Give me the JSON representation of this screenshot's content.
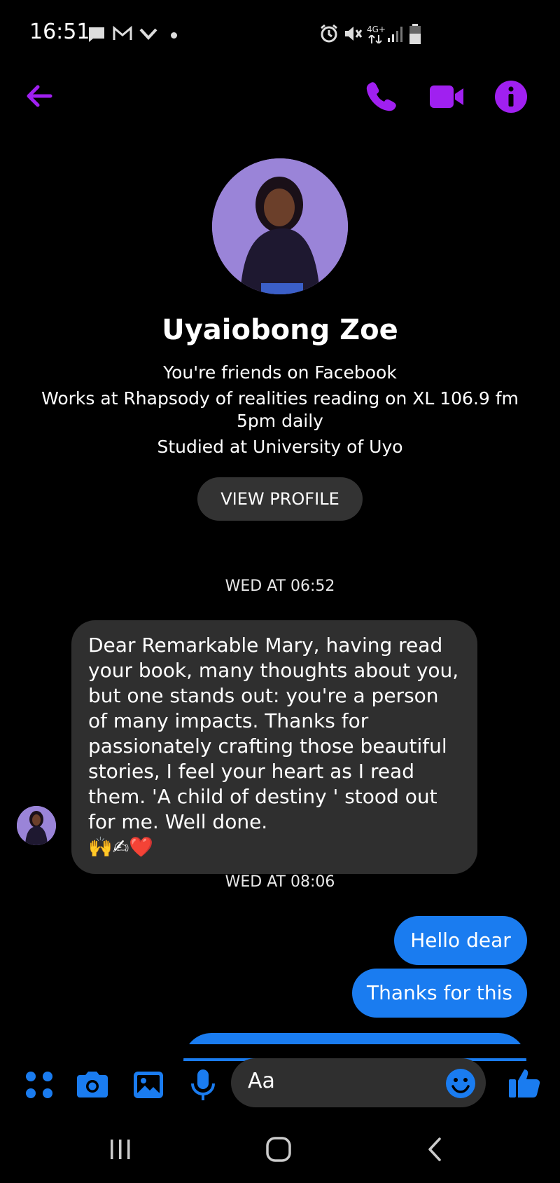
{
  "status_bar": {
    "time": "16:51",
    "left_icons": [
      "chat-bubble-icon",
      "gmail-icon",
      "check-icon",
      "dot-icon"
    ],
    "right_icons": [
      "alarm-icon",
      "mute-icon",
      "network-4g-icon",
      "signal-icon",
      "battery-icon"
    ],
    "network_label": "4G+"
  },
  "header": {
    "accent_color": "#a020f0",
    "icons": [
      "back-arrow-icon",
      "phone-icon",
      "video-icon",
      "info-icon"
    ]
  },
  "profile": {
    "name": "Uyaiobong Zoe",
    "friends_line": "You're friends on Facebook",
    "work_line": "Works at Rhapsody of realities reading on XL 106.9 fm 5pm daily",
    "study_line": "Studied at University of Uyo",
    "view_profile_label": "VIEW PROFILE"
  },
  "conversation": {
    "timestamp_1": "WED AT 06:52",
    "incoming_message": "Dear Remarkable Mary, having read your book, many thoughts about you, but one stands out: you're a person of many impacts. Thanks for passionately crafting those beautiful stories, I feel your heart as I read them. 'A child of destiny ' stood out for me. Well done.",
    "incoming_emojis": "🙌✍❤️",
    "timestamp_2": "WED AT 08:06",
    "outgoing_1": "Hello dear",
    "outgoing_2": "Thanks for this",
    "outgoing_color": "#1a7cf0"
  },
  "composer": {
    "placeholder": "Aa",
    "tool_icons": [
      "apps-icon",
      "camera-icon",
      "gallery-icon",
      "microphone-icon",
      "emoji-icon",
      "like-icon"
    ],
    "tool_color": "#1a7cf0"
  },
  "nav_bar": {
    "icons": [
      "recents-icon",
      "home-icon",
      "back-icon"
    ]
  }
}
